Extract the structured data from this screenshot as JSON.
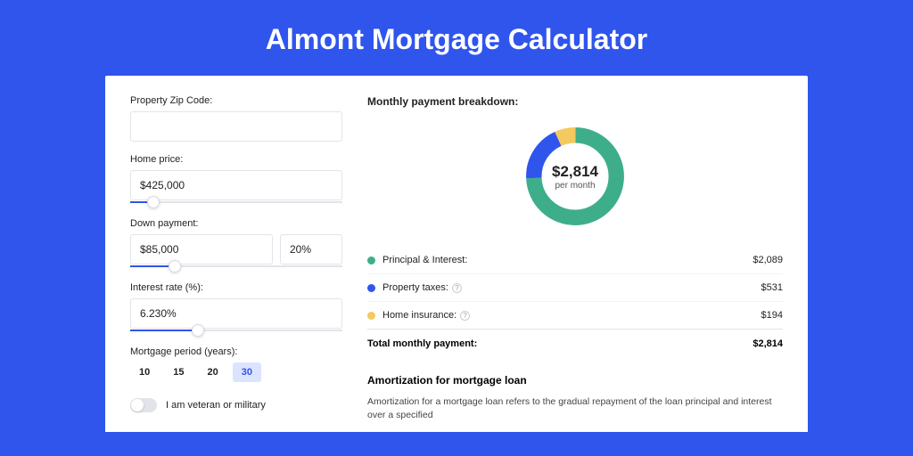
{
  "title": "Almont Mortgage Calculator",
  "fields": {
    "zip_label": "Property Zip Code:",
    "zip_value": "",
    "home_price_label": "Home price:",
    "home_price_value": "$425,000",
    "home_price_slider_pct": 11,
    "down_payment_label": "Down payment:",
    "down_payment_value": "$85,000",
    "down_payment_pct_value": "20%",
    "down_payment_slider_pct": 21,
    "interest_label": "Interest rate (%):",
    "interest_value": "6.230%",
    "interest_slider_pct": 32,
    "period_label": "Mortgage period (years):",
    "period_options": [
      "10",
      "15",
      "20",
      "30"
    ],
    "period_selected": "30",
    "veteran_label": "I am veteran or military"
  },
  "breakdown": {
    "title": "Monthly payment breakdown:",
    "center_amount": "$2,814",
    "center_sub": "per month",
    "rows": [
      {
        "label": "Principal & Interest:",
        "value": "$2,089",
        "color": "#3eae8a",
        "info": false
      },
      {
        "label": "Property taxes:",
        "value": "$531",
        "color": "#2f55ed",
        "info": true
      },
      {
        "label": "Home insurance:",
        "value": "$194",
        "color": "#f4c95d",
        "info": true
      }
    ],
    "total_label": "Total monthly payment:",
    "total_value": "$2,814"
  },
  "chart_data": {
    "type": "pie",
    "title": "Monthly payment breakdown",
    "categories": [
      "Principal & Interest",
      "Property taxes",
      "Home insurance"
    ],
    "values": [
      2089,
      531,
      194
    ],
    "colors": [
      "#3eae8a",
      "#2f55ed",
      "#f4c95d"
    ],
    "center_label": "$2,814 per month"
  },
  "amort": {
    "title": "Amortization for mortgage loan",
    "text": "Amortization for a mortgage loan refers to the gradual repayment of the loan principal and interest over a specified"
  }
}
